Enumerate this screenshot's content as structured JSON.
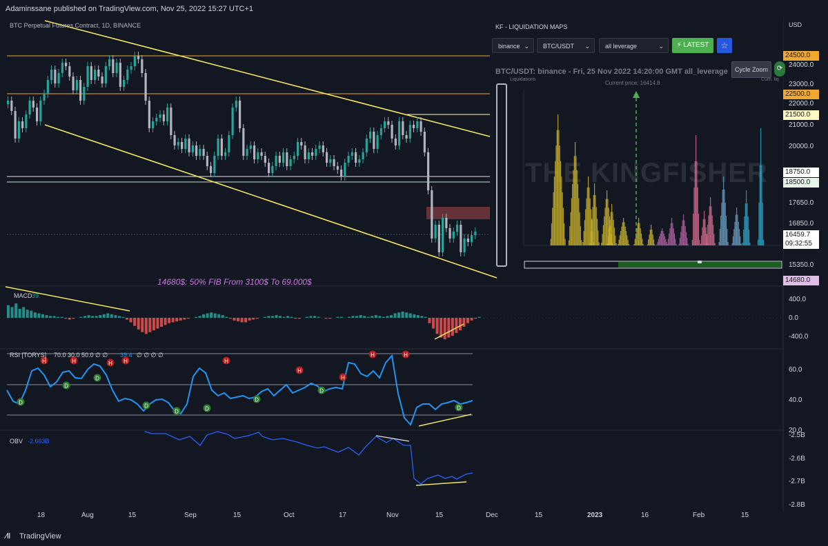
{
  "header": {
    "text": "Adaminssane published on TradingView.com, Nov 25, 2022 15:27 UTC+1"
  },
  "chart": {
    "symbol": "BTC Perpetual Futures Contract, 1D, BINANCE",
    "fib_annotation": "14680$: 50% FIB From 3100$ To 69.000$",
    "currency": "USD",
    "price_scale": [
      "24000.0",
      "23000.0",
      "22000.0",
      "21000.0",
      "20000.0",
      "17650.0",
      "16850.0",
      "15350.0"
    ],
    "price_tags": [
      {
        "label": "24500.0",
        "color": "#f0a830"
      },
      {
        "label": "22500.0",
        "color": "#f0a830"
      },
      {
        "label": "21500.0",
        "color": "#fff9c4"
      },
      {
        "label": "18750.0",
        "color": "#ffffff"
      },
      {
        "label": "18500.0",
        "color": "#e8f5e9"
      },
      {
        "label": "16459.7",
        "color": "#ffffff"
      },
      {
        "label": "09:32:55",
        "color": "#ffffff"
      },
      {
        "label": "14680.0",
        "color": "#e1bee7"
      }
    ],
    "time_labels": [
      "18",
      "Aug",
      "15",
      "Sep",
      "15",
      "Oct",
      "17",
      "Nov",
      "15",
      "Dec",
      "15",
      "2023",
      "16",
      "Feb",
      "15"
    ]
  },
  "macd": {
    "label": "MACD",
    "value": "39.",
    "scale": [
      "400.0",
      "0.0",
      "-400.0"
    ]
  },
  "rsi": {
    "label": "RSI [TORYS]",
    "params": "70.0  30.0  50.0  ∅  ∅",
    "value": "39.4",
    "trail": "∅  ∅  ∅  ∅",
    "scale": [
      "60.0",
      "40.0",
      "20.0"
    ],
    "marker_h": "H",
    "marker_d": "D"
  },
  "obv": {
    "label": "OBV",
    "value": "-2.663B",
    "scale": [
      "-2.5B",
      "-2.6B",
      "-2.7B",
      "-2.8B"
    ]
  },
  "kf": {
    "title": "KF - LIQUIDATION MAPS",
    "exchange": "binance",
    "pair": "BTC/USDT",
    "leverage": "all leverage",
    "latest": "LATEST",
    "heading": "BTC/USDT: binance - Fri, 25 Nov 2022 14:20:00 GMT all_leverage",
    "current_price": "Current price: 16414.8",
    "liq_label": "Liquidations",
    "cum_label": "Cum. liq",
    "cycle_zoom": "Cycle Zoom",
    "watermark": "THE KINGFISHER",
    "icons": {
      "star": "star-icon",
      "bolt": "bolt-icon",
      "reload": "reload-icon"
    }
  },
  "footer": {
    "brand": "TradingView"
  },
  "colors": {
    "bull": "#26a69a",
    "bear": "#ef5350",
    "trend": "#f5e663",
    "rsi": "#2196f3",
    "obv": "#2962ff",
    "fib": "#c878e0"
  }
}
